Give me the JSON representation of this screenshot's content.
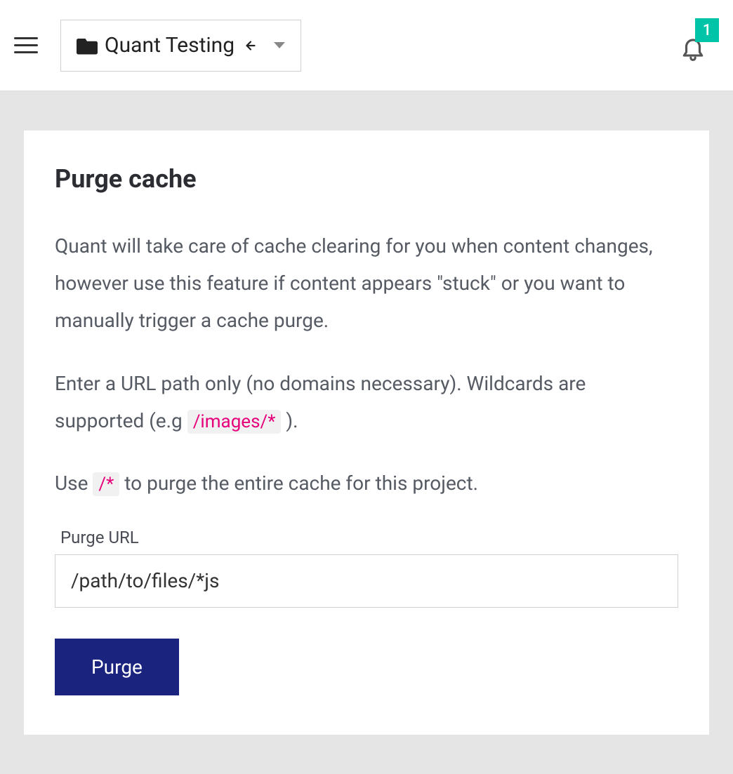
{
  "header": {
    "project_name": "Quant Testing",
    "notification_count": "1"
  },
  "card": {
    "title": "Purge cache",
    "paragraph1": "Quant will take care of cache clearing for you when content changes, however use this feature if content appears \"stuck\" or you want to manually trigger a cache purge.",
    "paragraph2_prefix": "Enter a URL path only (no domains necessary). Wildcards are supported (e.g ",
    "paragraph2_code": "/images/*",
    "paragraph2_suffix": " ).",
    "paragraph3_prefix": "Use ",
    "paragraph3_code": "/*",
    "paragraph3_suffix": " to purge the entire cache for this project.",
    "field_label": "Purge URL",
    "field_value": "/path/to/files/*js",
    "button_label": "Purge"
  }
}
